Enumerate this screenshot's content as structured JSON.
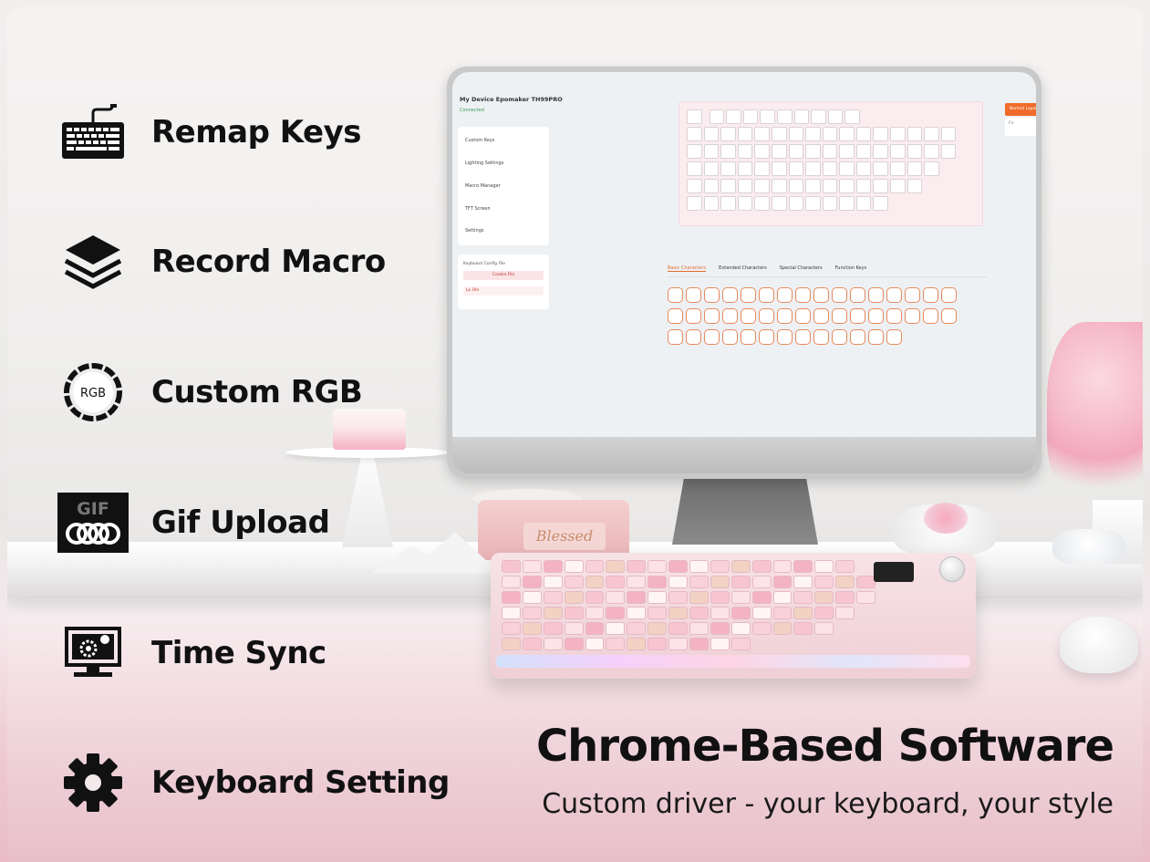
{
  "features": [
    {
      "label": "Remap Keys",
      "icon": "keyboard-icon"
    },
    {
      "label": "Record Macro",
      "icon": "layers-icon"
    },
    {
      "label": "Custom RGB",
      "icon": "rgb-icon",
      "icon_text": "RGB"
    },
    {
      "label": "Gif Upload",
      "icon": "gif-icon",
      "icon_text": "GIF"
    },
    {
      "label": "Time Sync",
      "icon": "monitor-sync-icon"
    },
    {
      "label": "Keyboard Setting",
      "icon": "gear-icon"
    }
  ],
  "software": {
    "device_title": "My Device Epomaker TH99PRO",
    "status": "Connected",
    "nav": [
      "Custom Keys",
      "Lighting Settings",
      "Macro Manager",
      "TFT Screen",
      "Settings"
    ],
    "config_title": "Keyboard Config File",
    "config_value": "Cookie.File",
    "config_row": "Lo Ole",
    "tabs": [
      "Basic Characters",
      "Extended Characters",
      "Special Characters",
      "Function Keys"
    ],
    "active_tab": 0,
    "action_button": "Normal Layer",
    "side_text": "Fn",
    "accent": "#f06b2b"
  },
  "decor": {
    "player_script": "Blessed"
  },
  "headline": "Chrome-Based Software",
  "subline": "Custom driver - your keyboard, your style"
}
